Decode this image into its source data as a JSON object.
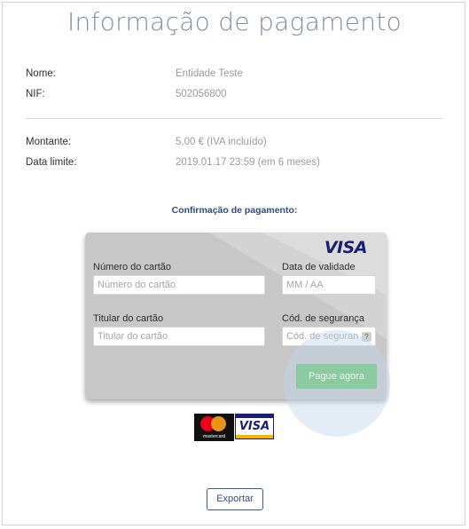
{
  "page": {
    "title": "Informação de pagamento"
  },
  "entity": {
    "name_label": "Nome:",
    "name_value": "Entidade Teste",
    "nif_label": "NIF:",
    "nif_value": "502056800"
  },
  "payment": {
    "amount_label": "Montante:",
    "amount_value": "5,00 € (IVA incluído)",
    "deadline_label": "Data limite:",
    "deadline_value": "2019.01.17 23:59 (em 6 meses)"
  },
  "confirmation": {
    "heading": "Confirmação de pagamento:"
  },
  "card_form": {
    "brand": "VISA",
    "card_number_label": "Número do cartão",
    "card_number_placeholder": "Número do cartão",
    "expiry_label": "Data de validade",
    "expiry_placeholder": "MM / AA",
    "holder_label": "Titular do cartão",
    "holder_placeholder": "Titular do cartão",
    "cvv_label": "Cód. de segurança",
    "cvv_placeholder": "Cód. de seguran",
    "cvv_help": "?",
    "submit_label": "Pague agora"
  },
  "accepted_cards": {
    "mastercard_text": "mastercard",
    "visa_text": "VISA"
  },
  "actions": {
    "export_label": "Exportar"
  },
  "colors": {
    "title": "#7f8ea3",
    "accent": "#2f4c7a",
    "pay_button": "#8bc9a0",
    "card_bg": "#c7c7c7"
  }
}
